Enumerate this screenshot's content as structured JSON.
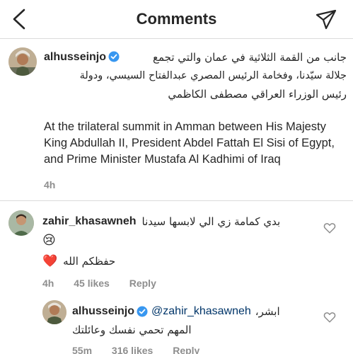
{
  "header": {
    "title": "Comments",
    "back_icon": "chevron-left-icon",
    "send_icon": "paper-plane-icon"
  },
  "caption": {
    "username": "alhusseinjo",
    "arabic_line1": "جانب من القمة الثلاثية في عمان والتي تجمع",
    "arabic_line2": "جلالة سيّدنا، وفخامة الرئيس المصري عبدالفتاح السيسي، ودولة",
    "arabic_line3": "رئيس الوزراء العراقي مصطفى الكاظمي",
    "english": "At the trilateral summit in Amman between His Majesty King Abdullah II, President Abdel Fattah El Sisi of Egypt, and Prime Minister Mustafa Al Kadhimi of Iraq",
    "time": "4h"
  },
  "comments": [
    {
      "username": "zahir_khasawneh",
      "text_line1": "بدي كمامة زي الي لابسها سيدنا",
      "emoji1": "😢",
      "text_line2": "حفظكم الله",
      "emoji2": "❤️",
      "time": "4h",
      "likes": "45 likes",
      "reply": "Reply"
    },
    {
      "username": "alhusseinjo",
      "mention": "@zahir_khasawneh",
      "text_line1": "ابشر،",
      "text_line2": "المهم تحمي نفسك وعائلتك",
      "time": "55m",
      "likes": "316 likes",
      "reply": "Reply"
    }
  ],
  "colors": {
    "text": "#262626",
    "meta": "#8e8e8e",
    "verified": "#3897f0",
    "mention": "#003569",
    "divider": "#dbdbdb"
  }
}
